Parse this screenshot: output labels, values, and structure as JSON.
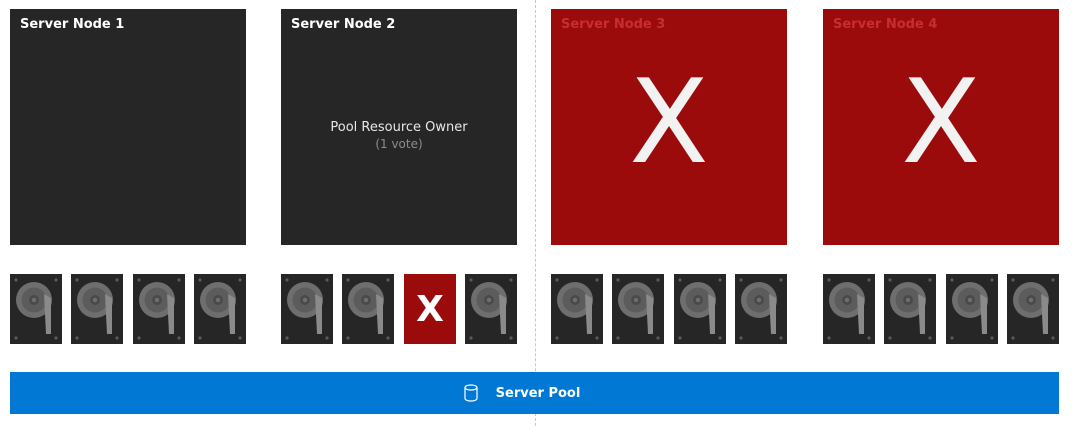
{
  "nodes": [
    {
      "title": "Server Node 1",
      "state": "ok"
    },
    {
      "title": "Server Node 2",
      "state": "ok",
      "role_label": "Pool Resource Owner",
      "vote_label": "(1 vote)"
    },
    {
      "title": "Server Node 3",
      "state": "failed",
      "fail_mark": "X"
    },
    {
      "title": "Server Node 4",
      "state": "failed",
      "fail_mark": "X"
    }
  ],
  "disks": {
    "failed_mark": "X",
    "node2_failed_index": 2
  },
  "pool": {
    "label": "Server Pool",
    "icon": "database-icon"
  },
  "colors": {
    "node_ok": "#262626",
    "node_failed": "#9b0b0b",
    "pool_bar": "#0078d4"
  }
}
